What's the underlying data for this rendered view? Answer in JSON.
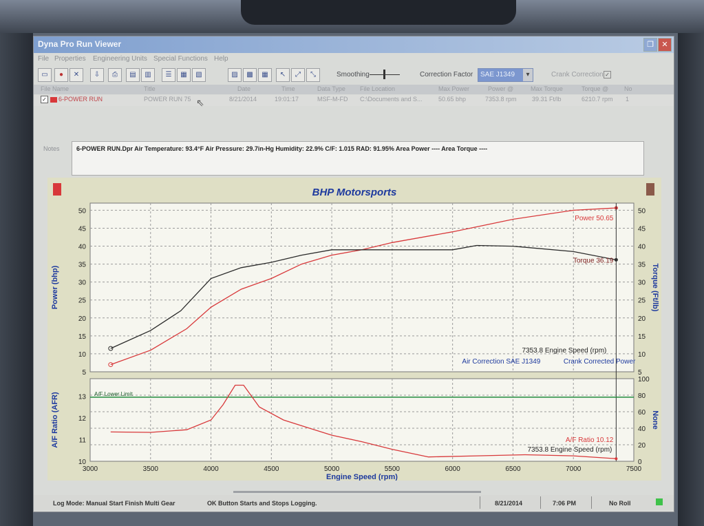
{
  "window": {
    "title": "Dyna Pro Run Viewer"
  },
  "menu": [
    "File",
    "Properties",
    "Engineering Units",
    "Special Functions",
    "Help"
  ],
  "toolbar": {
    "smoothing_label": "Smoothing",
    "correction_label": "Correction Factor",
    "correction_value": "SAE J1349",
    "crank_label": "Crank Correction"
  },
  "file_list": {
    "columns": [
      "File Name",
      "Title",
      "Date",
      "Time",
      "Data Type",
      "File Location",
      "Max Power",
      "Power @",
      "Max Torque",
      "Torque @",
      "No"
    ],
    "rows": [
      [
        "6-POWER RUN",
        "POWER RUN 75",
        "8/21/2014",
        "19:01:17",
        "MSF-M-FD",
        "C:\\Documents and S...",
        "50.65 bhp",
        "7353.8 rpm",
        "39.31 Ft/lb",
        "6210.7 rpm",
        "1"
      ]
    ]
  },
  "notes": {
    "label": "Notes",
    "text": "6-POWER RUN.Dpr  Air Temperature: 93.4°F   Air Pressure: 29.7in-Hg   Humidity: 22.9%   C/F: 1.015   RAD: 91.95%  Area Power ----   Area Torque ----"
  },
  "status": {
    "log_mode": "Log Mode:  Manual Start Finish   Multi Gear",
    "message": "OK Button Starts and Stops Logging.",
    "date": "8/21/2014",
    "time": "7:06 PM",
    "roll": "No Roll"
  },
  "colors": {
    "power": "#d8383a",
    "torque": "#2a2a2a",
    "afr": "#d8383a",
    "afr_limit": "#1f8a3a",
    "labels": "#1e3a9e"
  },
  "chart_data": [
    {
      "type": "line",
      "title": "BHP Motorsports",
      "xlabel": "Engine Speed (rpm)",
      "ylabel": "Power (bhp)",
      "y2label": "Torque (Ft/lb)",
      "xlim": [
        3000,
        7500
      ],
      "ylim": [
        5,
        52
      ],
      "y2lim": [
        5,
        52
      ],
      "x_ticks": [
        3000,
        3500,
        4000,
        4500,
        5000,
        5500,
        6000,
        6500,
        7000,
        7500
      ],
      "y_ticks": [
        5,
        10,
        15,
        20,
        25,
        30,
        35,
        40,
        45,
        50
      ],
      "y2_ticks": [
        5,
        10,
        15,
        20,
        25,
        30,
        35,
        40,
        45,
        50
      ],
      "series": [
        {
          "name": "Power",
          "label": "Power 50.65",
          "x": [
            3170,
            3500,
            3800,
            4000,
            4250,
            4500,
            4750,
            5000,
            5250,
            5500,
            6000,
            6500,
            7000,
            7354
          ],
          "y": [
            7,
            11,
            17,
            23,
            28,
            31,
            35,
            37.5,
            39,
            41,
            44,
            47.5,
            50,
            50.65
          ]
        },
        {
          "name": "Torque",
          "label": "Torque 36.19",
          "x": [
            3170,
            3500,
            3750,
            4000,
            4250,
            4500,
            4750,
            5000,
            5250,
            5500,
            6000,
            6200,
            6500,
            7000,
            7354
          ],
          "y": [
            11.5,
            16.5,
            22,
            31,
            34,
            35.5,
            37.5,
            39,
            39,
            39,
            39,
            40.2,
            40,
            38.5,
            36.19
          ]
        }
      ],
      "cursor_label": "7353.8 Engine Speed (rpm)",
      "annotations": [
        "Air Correction SAE J1349",
        "Crank Corrected Power"
      ]
    },
    {
      "type": "line",
      "xlabel": "Engine Speed (rpm)",
      "ylabel": "A/F Ratio (AFR)",
      "y2label": "None",
      "xlim": [
        3000,
        7500
      ],
      "ylim": [
        10,
        13.8
      ],
      "y2lim": [
        0,
        100
      ],
      "y_ticks": [
        10,
        11,
        12,
        13
      ],
      "y2_ticks": [
        0,
        20,
        40,
        60,
        80,
        100
      ],
      "limit_line": {
        "label": "A/F Lower Limit",
        "value": 12.95
      },
      "series": [
        {
          "name": "A/F Ratio",
          "label": "A/F Ratio 10.12",
          "x": [
            3170,
            3500,
            3800,
            4000,
            4100,
            4200,
            4270,
            4400,
            4600,
            4800,
            5000,
            5250,
            5500,
            5800,
            6200,
            6600,
            7000,
            7354
          ],
          "y": [
            11.35,
            11.33,
            11.45,
            11.9,
            12.6,
            13.5,
            13.5,
            12.5,
            11.9,
            11.55,
            11.2,
            10.9,
            10.55,
            10.2,
            10.25,
            10.3,
            10.25,
            10.12
          ]
        }
      ],
      "cursor_label": "7353.8 Engine Speed (rpm)"
    }
  ]
}
